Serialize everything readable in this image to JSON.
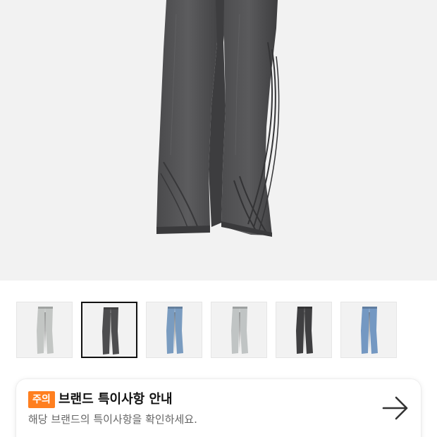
{
  "product": {
    "main_image": "gray-wash-wide-jeans",
    "thumbnails": [
      {
        "image": "light-vintage-wash-jeans",
        "wash": "#c3c6c4",
        "selected": false
      },
      {
        "image": "gray-wash-jeans",
        "wash": "#4d4d4f",
        "selected": true
      },
      {
        "image": "medium-blue-wash-jeans",
        "wash": "#7a9cc0",
        "selected": false
      },
      {
        "image": "light-vintage-wash-jeans",
        "wash": "#c0c4c4",
        "selected": false
      },
      {
        "image": "black-wash-jeans",
        "wash": "#3f3f41",
        "selected": false
      },
      {
        "image": "blue-wash-jeans",
        "wash": "#7498c2",
        "selected": false
      }
    ]
  },
  "notice": {
    "badge": "주의",
    "title": "브랜드 특이사항 안내",
    "description": "해당 브랜드의 특이사항을 확인하세요.",
    "arrow_icon": "arrow-right-icon"
  },
  "colors": {
    "badge": "#ff7f1f",
    "hero_bg": "#f2f2f2",
    "selected_border": "#111111"
  }
}
